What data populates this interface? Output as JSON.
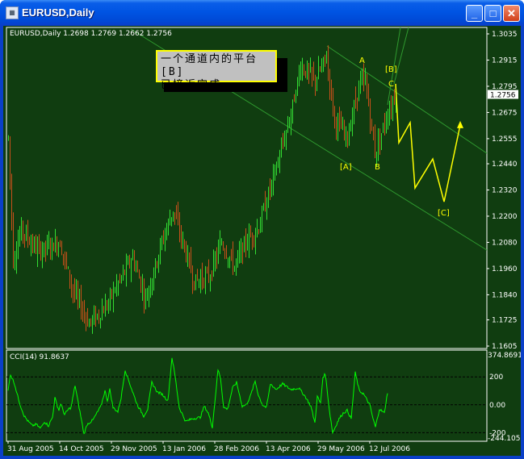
{
  "window": {
    "title": "EUREUSD,Daily",
    "icon": "chart-window-icon",
    "buttons": [
      "minimize",
      "maximize",
      "close"
    ]
  },
  "chart": {
    "header": "EURUSD,Daily  1.2698 1.2769 1.2662 1.2756",
    "symbol": "EURUSD",
    "timeframe": "Daily",
    "ohlc": {
      "open": 1.2698,
      "high": 1.2769,
      "low": 1.2662,
      "close": 1.2756
    },
    "current_price_label": "1.2756",
    "price_ticks": [
      "1.3035",
      "1.2915",
      "1.2795",
      "1.2675",
      "1.2555",
      "1.2440",
      "1.2320",
      "1.2200",
      "1.2080",
      "1.1960",
      "1.1840",
      "1.1725",
      "1.1605"
    ],
    "price_range": [
      1.1605,
      1.3035
    ],
    "date_ticks": [
      "31 Aug 2005",
      "14 Oct 2005",
      "29 Nov 2005",
      "13 Jan 2006",
      "28 Feb 2006",
      "13 Apr 2006",
      "29 May 2006",
      "12 Jul 2006"
    ],
    "bars_between_date_ticks": 32,
    "note_lines": [
      "一个通道内的平台[B]",
      "已接近完成"
    ],
    "wave_labels": {
      "A_top": "A",
      "B_bracket": "[B]",
      "C": "C",
      "A_bracket": "[A]",
      "B": "B",
      "C_bracket": "[C]"
    },
    "price_path": [
      [
        0,
        1.256
      ],
      [
        3,
        1.2
      ],
      [
        8,
        1.214
      ],
      [
        18,
        1.204
      ],
      [
        32,
        1.208
      ],
      [
        40,
        1.186
      ],
      [
        50,
        1.171
      ],
      [
        60,
        1.178
      ],
      [
        67,
        1.188
      ],
      [
        77,
        1.201
      ],
      [
        85,
        1.182
      ],
      [
        95,
        1.208
      ],
      [
        102,
        1.223
      ],
      [
        115,
        1.19
      ],
      [
        125,
        1.193
      ],
      [
        132,
        1.208
      ],
      [
        140,
        1.197
      ],
      [
        147,
        1.208
      ],
      [
        155,
        1.215
      ],
      [
        167,
        1.245
      ],
      [
        175,
        1.267
      ],
      [
        181,
        1.289
      ],
      [
        190,
        1.282
      ],
      [
        197,
        1.293
      ],
      [
        202,
        1.264
      ],
      [
        210,
        1.256
      ],
      [
        217,
        1.28
      ],
      [
        221,
        1.282
      ],
      [
        227,
        1.249
      ],
      [
        234,
        1.265
      ],
      [
        240,
        1.2765
      ]
    ],
    "projection_path": [
      [
        240,
        1.2806
      ],
      [
        242,
        1.2536
      ],
      [
        249,
        1.2629
      ],
      [
        252,
        1.2329
      ],
      [
        263,
        1.2462
      ],
      [
        270,
        1.2266
      ],
      [
        280,
        1.2618
      ]
    ],
    "colors": {
      "background": "#103d10",
      "up_bar": "#33dd33",
      "down_bar": "#c8501a",
      "projection": "#ffff00",
      "channel": "#2f9a2f"
    }
  },
  "indicator": {
    "header": "CCI(14) 91.8637",
    "name": "CCI",
    "period": 14,
    "value": 91.8637,
    "scale_max_label": "374.8691",
    "scale_min_label": "-244.105",
    "levels": [
      "200",
      "0.00",
      "-200"
    ],
    "range": [
      -244.105,
      374.8691
    ],
    "color": "#00ff00",
    "series": [
      [
        0,
        100
      ],
      [
        1.5,
        220
      ],
      [
        4,
        150
      ],
      [
        6,
        60
      ],
      [
        7.5,
        0
      ],
      [
        10,
        -80
      ],
      [
        12.5,
        -120
      ],
      [
        15,
        -150
      ],
      [
        17.5,
        -140
      ],
      [
        20,
        -170
      ],
      [
        22.5,
        -120
      ],
      [
        25,
        -150
      ],
      [
        27.5,
        -90
      ],
      [
        29,
        50
      ],
      [
        30,
        10
      ],
      [
        31.5,
        -40
      ],
      [
        32.5,
        10
      ],
      [
        35,
        -70
      ],
      [
        37.5,
        -30
      ],
      [
        39,
        -20
      ],
      [
        41.5,
        140
      ],
      [
        43.5,
        10
      ],
      [
        45,
        -80
      ],
      [
        47,
        -210
      ],
      [
        49,
        -140
      ],
      [
        52.5,
        -110
      ],
      [
        57.5,
        -10
      ],
      [
        60,
        100
      ],
      [
        61.5,
        30
      ],
      [
        63,
        110
      ],
      [
        65,
        -20
      ],
      [
        68,
        -50
      ],
      [
        70,
        50
      ],
      [
        72.5,
        250
      ],
      [
        76,
        130
      ],
      [
        80,
        0
      ],
      [
        84,
        -80
      ],
      [
        86.5,
        -30
      ],
      [
        89,
        160
      ],
      [
        92.5,
        90
      ],
      [
        95,
        80
      ],
      [
        99,
        30
      ],
      [
        101.5,
        340
      ],
      [
        103.5,
        200
      ],
      [
        106,
        -20
      ],
      [
        110,
        -120
      ],
      [
        114,
        -100
      ],
      [
        119,
        -90
      ],
      [
        121.5,
        -10
      ],
      [
        124,
        -60
      ],
      [
        126.5,
        -160
      ],
      [
        130,
        250
      ],
      [
        131.5,
        200
      ],
      [
        133.5,
        -20
      ],
      [
        136,
        -30
      ],
      [
        139,
        120
      ],
      [
        141.5,
        160
      ],
      [
        145,
        -10
      ],
      [
        147.5,
        0
      ],
      [
        150,
        60
      ],
      [
        153,
        170
      ],
      [
        155,
        70
      ],
      [
        157.5,
        0
      ],
      [
        160,
        -20
      ],
      [
        162.5,
        150
      ],
      [
        166,
        110
      ],
      [
        170,
        150
      ],
      [
        175,
        110
      ],
      [
        180,
        120
      ],
      [
        184,
        60
      ],
      [
        187.5,
        -10
      ],
      [
        190,
        -130
      ],
      [
        191.5,
        60
      ],
      [
        193.5,
        10
      ],
      [
        195,
        200
      ],
      [
        196.5,
        220
      ],
      [
        199,
        -40
      ],
      [
        201,
        -200
      ],
      [
        205,
        -100
      ],
      [
        207.5,
        -60
      ],
      [
        210,
        -40
      ],
      [
        212.5,
        -100
      ],
      [
        215,
        230
      ],
      [
        217.5,
        100
      ],
      [
        220,
        80
      ],
      [
        224,
        0
      ],
      [
        226,
        -100
      ],
      [
        227.5,
        -160
      ],
      [
        230,
        -30
      ],
      [
        233,
        -60
      ],
      [
        235,
        90
      ]
    ]
  }
}
